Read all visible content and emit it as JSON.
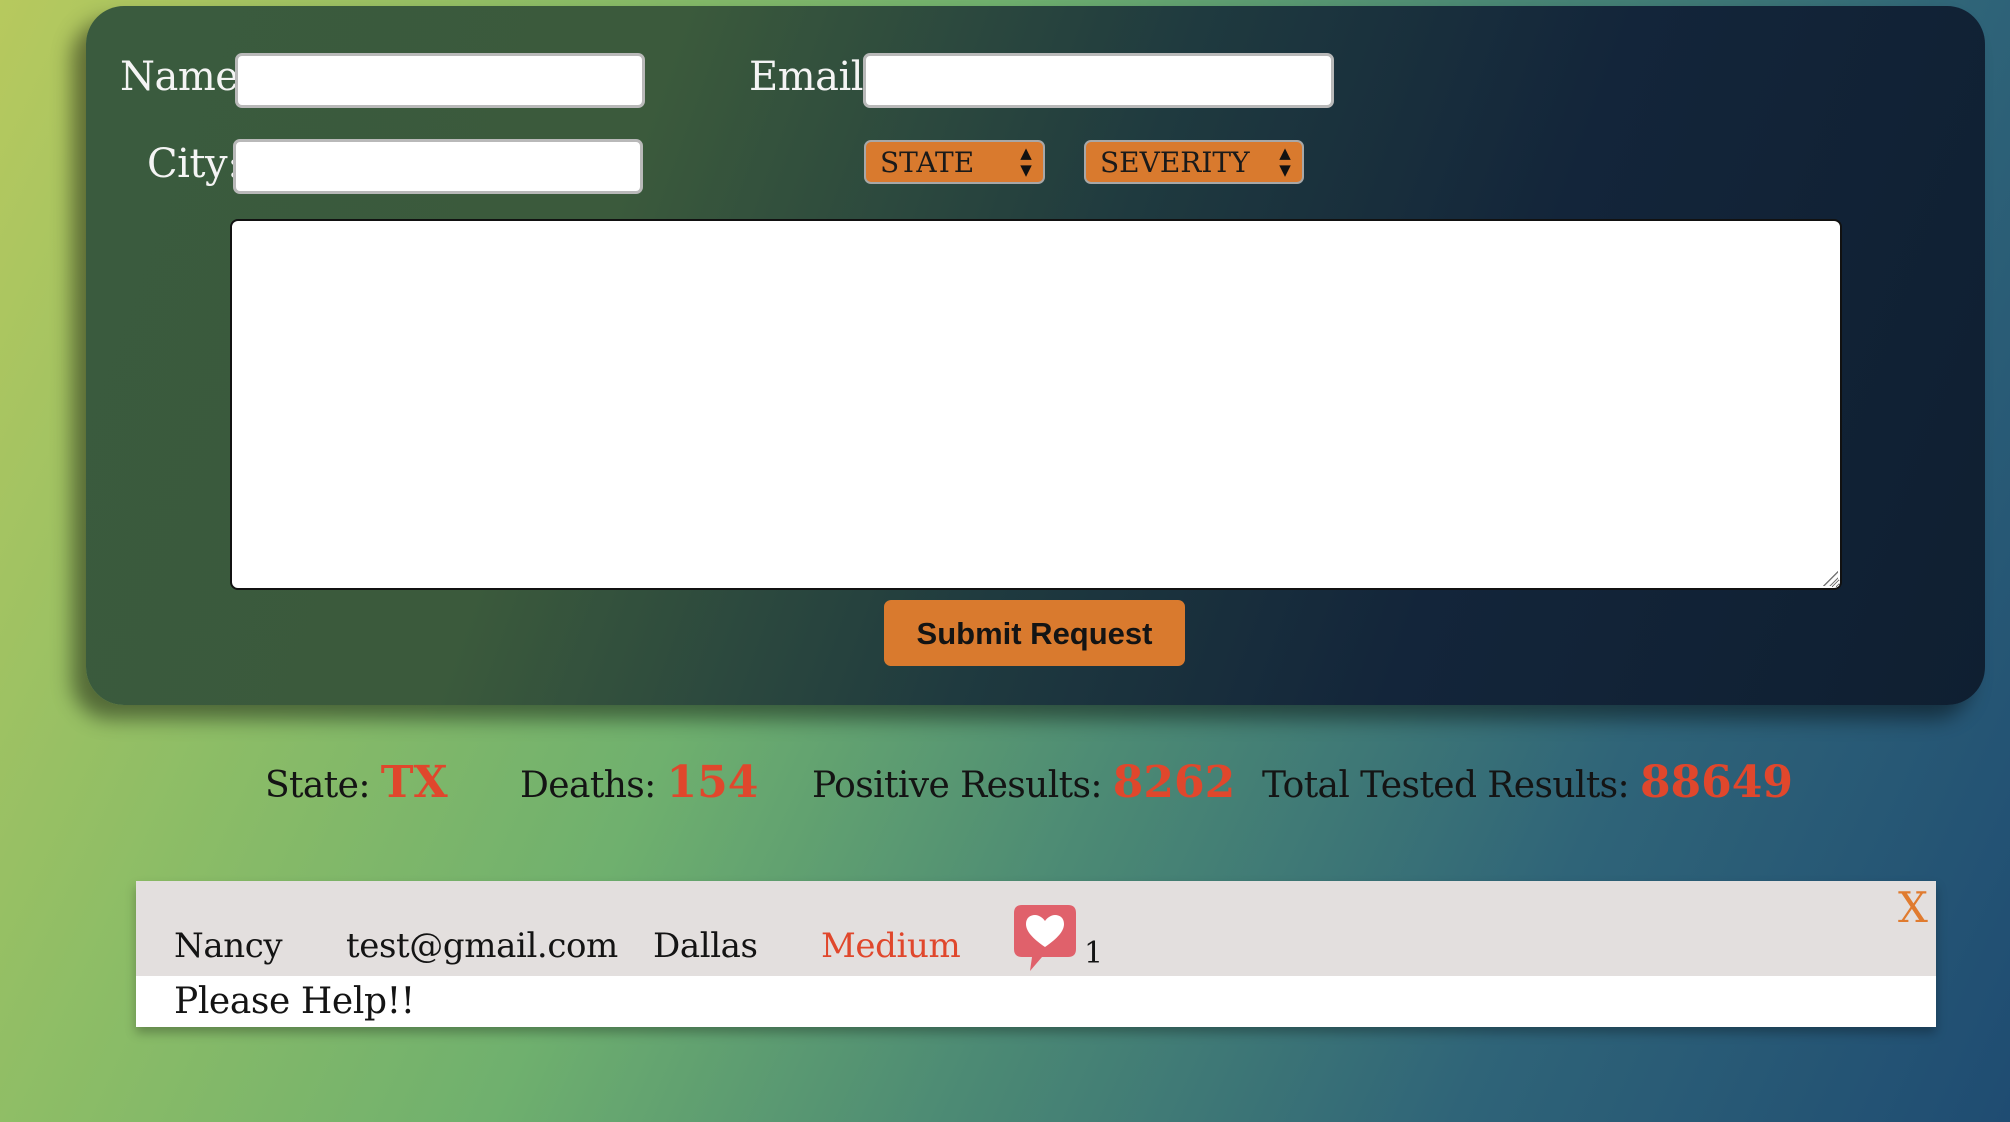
{
  "form": {
    "name_label": "Name:",
    "name_value": "",
    "email_label": "Email:",
    "email_value": "",
    "city_label": "City:",
    "city_value": "",
    "state_select": "STATE",
    "severity_select": "SEVERITY",
    "message_value": "",
    "submit_label": "Submit Request",
    "accent_color": "#d97a2e"
  },
  "stats": {
    "state_label": "State:",
    "state_value": "TX",
    "deaths_label": "Deaths:",
    "deaths_value": "154",
    "positive_label": "Positive Results:",
    "positive_value": "8262",
    "tested_label": "Total Tested Results:",
    "tested_value": "88649",
    "value_color": "#e0472c"
  },
  "request_card": {
    "name": "Nancy",
    "email": "test@gmail.com",
    "city": "Dallas",
    "severity": "Medium",
    "likes": "1",
    "like_icon": "heart-speech-bubble-icon",
    "close_label": "X",
    "message": "Please Help!!"
  }
}
